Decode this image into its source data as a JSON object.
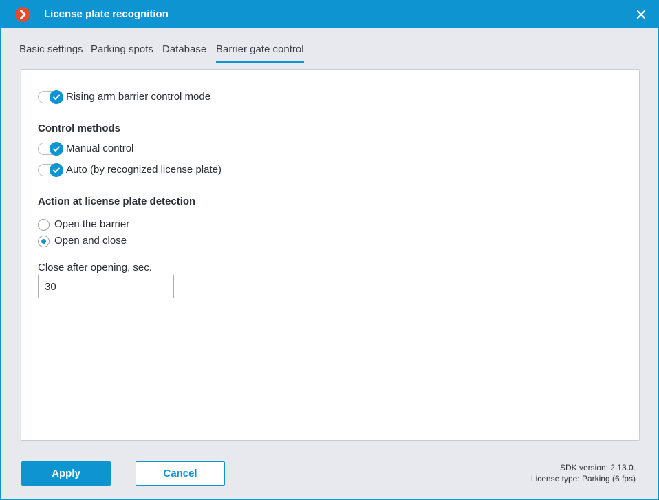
{
  "window": {
    "title": "License plate recognition",
    "accent_color": "#0f94d2",
    "logo_color": "#e8492d",
    "logo_icon": "chevron-right-icon",
    "close_icon": "close-icon"
  },
  "tabs": [
    {
      "label": "Basic settings",
      "active": false
    },
    {
      "label": "Parking spots",
      "active": false
    },
    {
      "label": "Database",
      "active": false
    },
    {
      "label": "Barrier gate control",
      "active": true
    }
  ],
  "barrier": {
    "rising_arm_mode": {
      "label": "Rising arm barrier control mode",
      "checked": true
    },
    "control_methods": {
      "title": "Control methods",
      "manual": {
        "label": "Manual control",
        "checked": true
      },
      "auto": {
        "label": "Auto (by recognized license plate)",
        "checked": true
      }
    },
    "action": {
      "title": "Action at license plate detection",
      "options": [
        {
          "label": "Open the barrier",
          "checked": false
        },
        {
          "label": "Open and close",
          "checked": true
        }
      ]
    },
    "close_after": {
      "label": "Close after opening, sec.",
      "value": "30"
    }
  },
  "footer": {
    "apply_label": "Apply",
    "cancel_label": "Cancel",
    "sdk_version": "SDK version: 2.13.0.",
    "license_type": "License type: Parking (6 fps)"
  }
}
